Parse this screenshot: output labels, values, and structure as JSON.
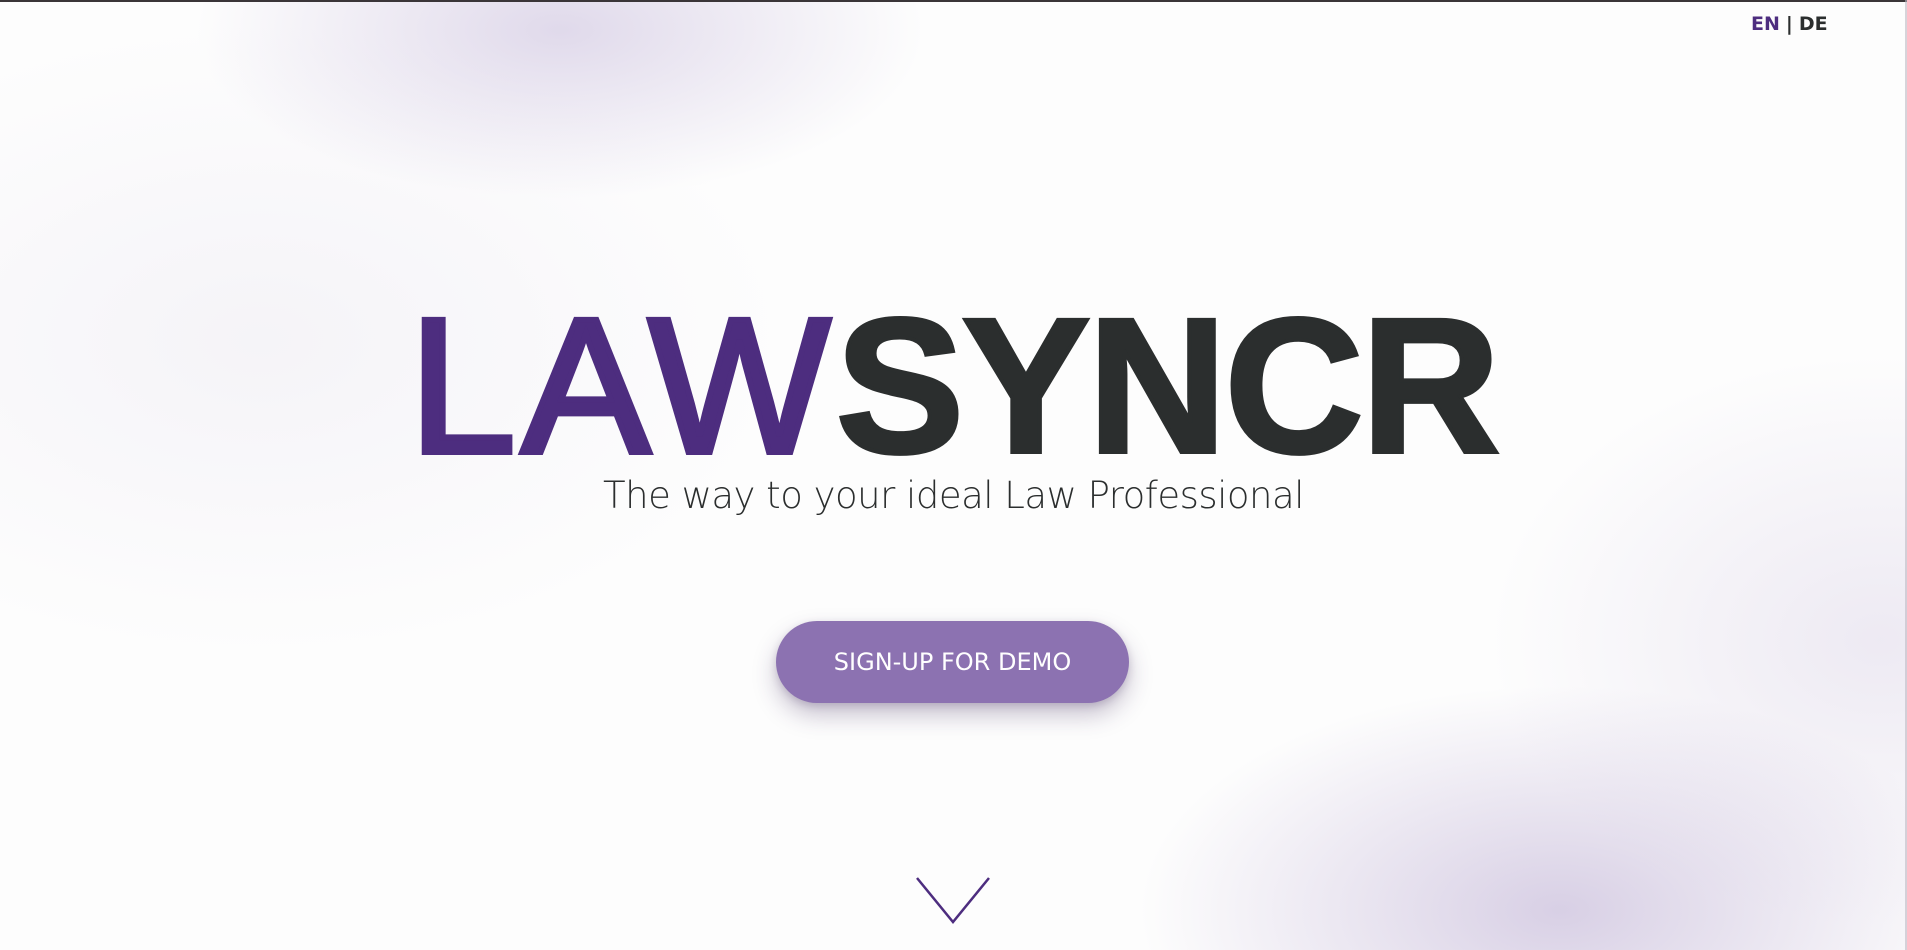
{
  "language_switch": {
    "en": "EN",
    "separator": "|",
    "de": "DE",
    "active": "EN"
  },
  "hero": {
    "logo_part_1": "LAW",
    "logo_part_2": "SYNCR",
    "tagline": "The way to your ideal Law Professional",
    "cta_label": "SIGN-UP FOR DEMO"
  },
  "icons": {
    "scroll": "chevron-down-icon"
  },
  "colors": {
    "brand_purple": "#4d2d7f",
    "brand_dark": "#2b2e2e",
    "button_bg": "#8c72b1",
    "button_text": "#ffffff"
  }
}
